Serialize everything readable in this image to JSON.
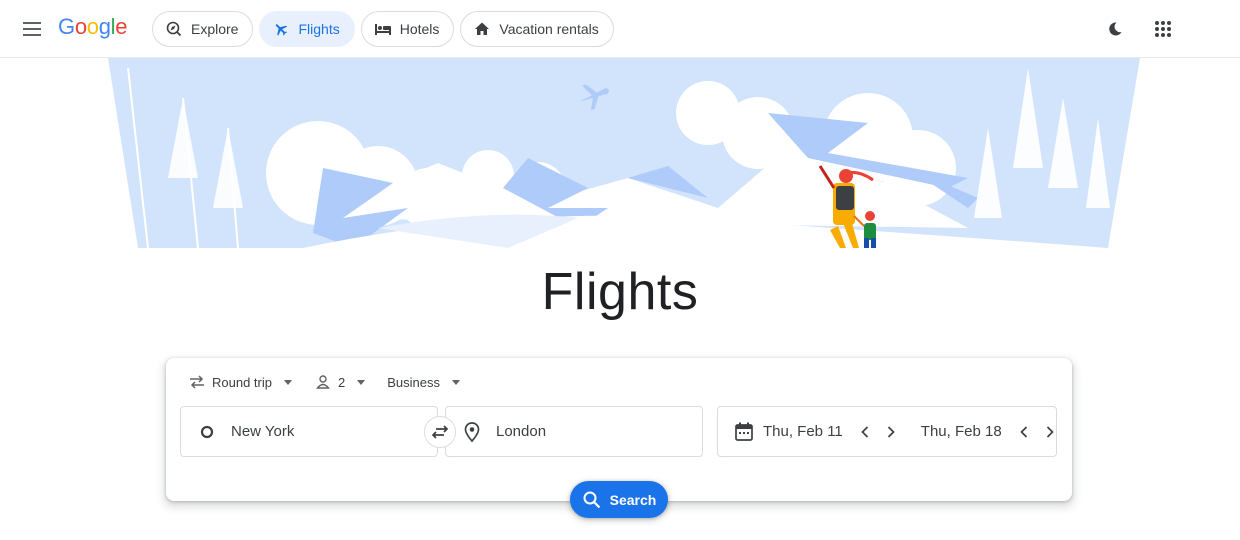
{
  "brand": {
    "logo_letters": [
      "G",
      "o",
      "o",
      "g",
      "l",
      "e"
    ],
    "logo_colors": [
      "#4285f4",
      "#ea4335",
      "#fbbc05",
      "#4285f4",
      "#34a853",
      "#ea4335"
    ]
  },
  "header": {
    "menu_icon": "hamburger-menu-icon",
    "tabs": [
      {
        "label": "Explore",
        "icon": "explore-icon",
        "active": false
      },
      {
        "label": "Flights",
        "icon": "airplane-icon",
        "active": true
      },
      {
        "label": "Hotels",
        "icon": "bed-icon",
        "active": false
      },
      {
        "label": "Vacation rentals",
        "icon": "house-icon",
        "active": false
      }
    ],
    "right_icons": [
      "dark-mode-moon-icon",
      "apps-grid-icon"
    ]
  },
  "hero": {
    "title": "Flights",
    "illustration": "mountain-landscape-with-traveler-illustration"
  },
  "search": {
    "trip_type": "Round trip",
    "passengers": "2",
    "cabin_class": "Business",
    "origin": "New York",
    "destination": "London",
    "depart_date": "Thu, Feb 11",
    "return_date": "Thu, Feb 18",
    "search_label": "Search"
  },
  "colors": {
    "accent": "#1a73e8",
    "active_tab_bg": "#e8f0fe",
    "illustration_blue": "#aecbfa"
  }
}
